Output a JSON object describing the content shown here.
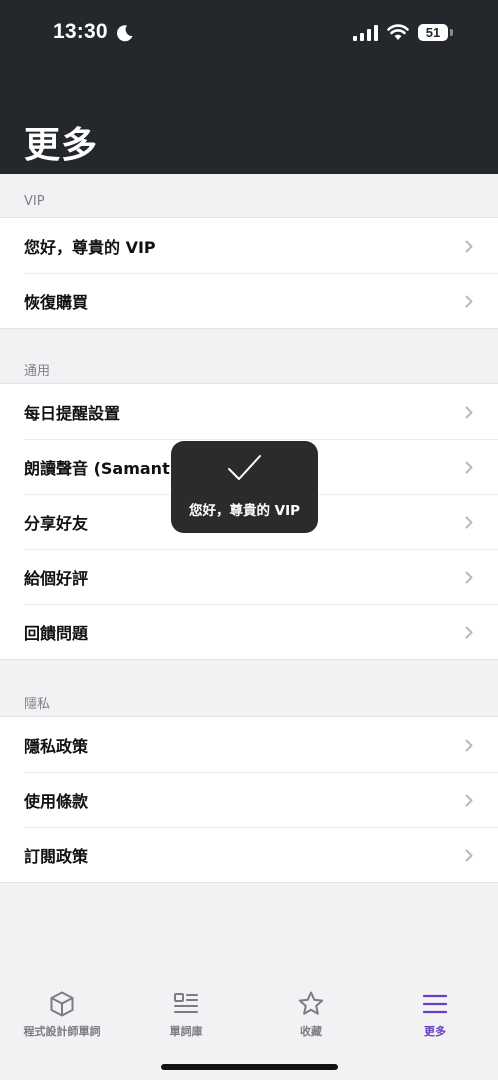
{
  "status_bar": {
    "time": "13:30",
    "battery": "51"
  },
  "header": {
    "title": "更多"
  },
  "sections": [
    {
      "label": "VIP",
      "items": [
        "您好，尊貴的 VIP",
        "恢復購買"
      ]
    },
    {
      "label": "通用",
      "items": [
        "每日提醒設置",
        "朗讀聲音 (Samantha)",
        "分享好友",
        "給個好評",
        "回饋問題"
      ]
    },
    {
      "label": "隱私",
      "items": [
        "隱私政策",
        "使用條款",
        "訂閱政策"
      ]
    }
  ],
  "toast": {
    "message": "您好，尊貴的 VIP"
  },
  "tabbar": {
    "tabs": [
      {
        "label": "程式設計師單詞",
        "icon": "cube-icon"
      },
      {
        "label": "單詞庫",
        "icon": "list-icon"
      },
      {
        "label": "收藏",
        "icon": "star-icon"
      },
      {
        "label": "更多",
        "icon": "menu-icon"
      }
    ],
    "active": "更多",
    "accent_color": "#6a3fc2"
  }
}
